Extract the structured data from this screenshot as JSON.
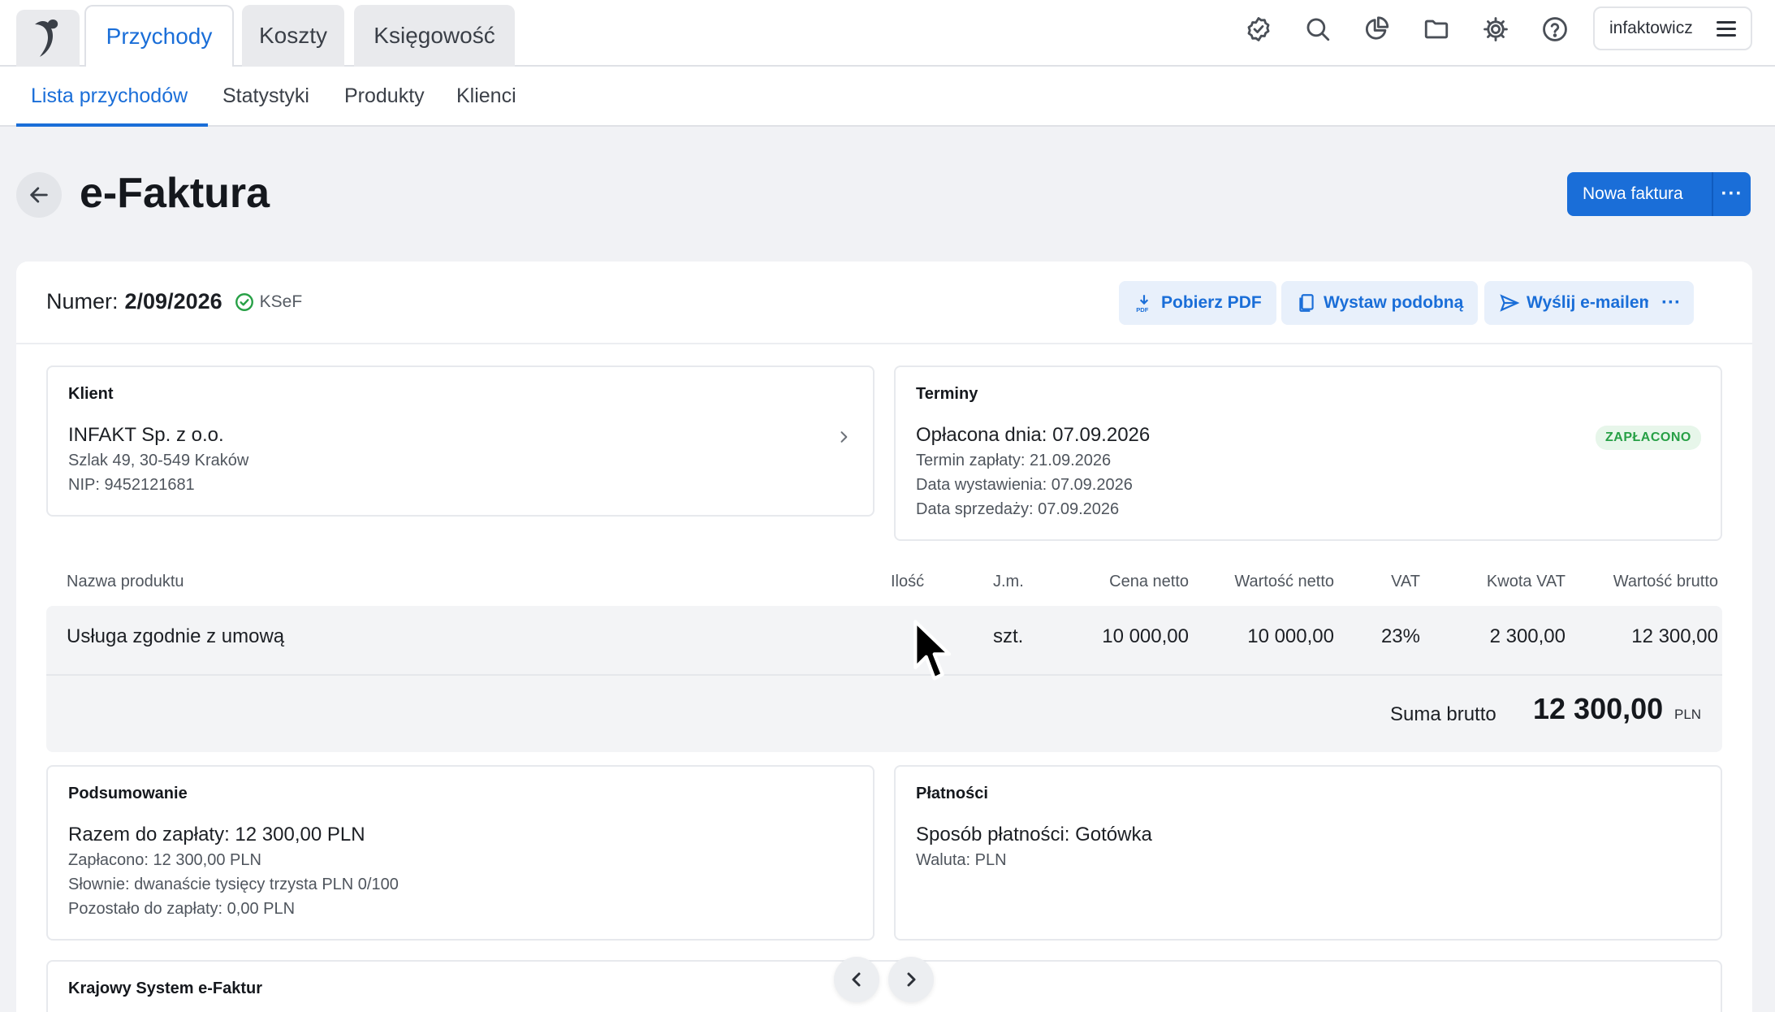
{
  "nav": {
    "tabs": [
      {
        "label": "Przychody",
        "active": true
      },
      {
        "label": "Koszty",
        "active": false
      },
      {
        "label": "Księgowość",
        "active": false
      }
    ],
    "icons": [
      "verified-icon",
      "search-icon",
      "pie-chart-icon",
      "folder-icon",
      "gear-icon",
      "help-icon"
    ],
    "user": "infaktowicz"
  },
  "subnav": {
    "tabs": [
      {
        "label": "Lista przychodów",
        "active": true
      },
      {
        "label": "Statystyki",
        "active": false
      },
      {
        "label": "Produkty",
        "active": false
      },
      {
        "label": "Klienci",
        "active": false
      }
    ]
  },
  "page": {
    "title": "e-Faktura",
    "new_invoice_label": "Nowa faktura",
    "more_label": "···"
  },
  "invoice": {
    "number_label": "Numer:",
    "number": "2/09/2026",
    "ksef_label": "KSeF",
    "actions": {
      "pdf": "Pobierz PDF",
      "similar": "Wystaw podobną",
      "email": "Wyślij e-mailem",
      "more": "···"
    },
    "client": {
      "title": "Klient",
      "name": "INFAKT Sp. z o.o.",
      "address": "Szlak 49, 30-549 Kraków",
      "nip": "NIP: 9452121681"
    },
    "terms": {
      "title": "Terminy",
      "paid_on": "Opłacona dnia: 07.09.2026",
      "due": "Termin zapłaty: 21.09.2026",
      "issued": "Data wystawienia: 07.09.2026",
      "sale": "Data sprzedaży: 07.09.2026",
      "status": "ZAPŁACONO"
    },
    "table": {
      "headers": {
        "name": "Nazwa produktu",
        "qty": "Ilość",
        "unit": "J.m.",
        "net_price": "Cena netto",
        "net_value": "Wartość netto",
        "vat": "VAT",
        "vat_amount": "Kwota VAT",
        "gross_value": "Wartość brutto"
      },
      "rows": [
        {
          "name": "Usługa zgodnie z umową",
          "qty": "",
          "unit": "szt.",
          "net_price": "10 000,00",
          "net_value": "10 000,00",
          "vat": "23%",
          "vat_amount": "2 300,00",
          "gross_value": "12 300,00"
        }
      ],
      "sum_label": "Suma brutto",
      "sum_value": "12 300,00",
      "sum_currency": "PLN"
    },
    "summary": {
      "title": "Podsumowanie",
      "total": "Razem do zapłaty: 12 300,00 PLN",
      "paid": "Zapłacono: 12 300,00 PLN",
      "words": "Słownie: dwanaście tysięcy trzysta PLN 0/100",
      "remaining": "Pozostało do zapłaty: 0,00 PLN"
    },
    "payments": {
      "title": "Płatności",
      "method": "Sposób płatności: Gotówka",
      "currency": "Waluta: PLN"
    },
    "ksef_section": {
      "title": "Krajowy System e-Faktur"
    }
  },
  "colors": {
    "accent": "#1a6ed8",
    "paid_badge_bg": "#e7f6ea",
    "paid_badge_text": "#27a046",
    "ksef_check": "#27a046"
  }
}
